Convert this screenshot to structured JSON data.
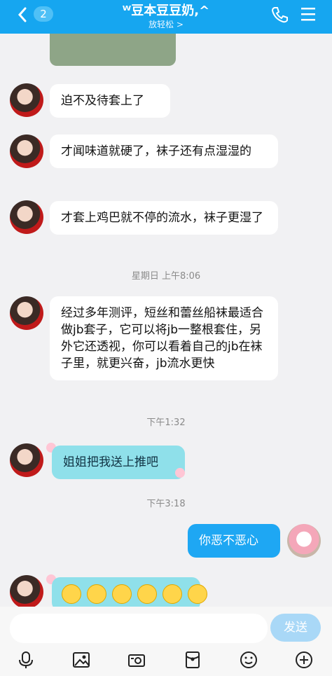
{
  "header": {
    "back_count": "2",
    "title": "ᵂ豆本豆豆奶,^",
    "subtitle": "放轻松 >",
    "colors": {
      "bar": "#16a6f0"
    },
    "icons": [
      "back-arrow-icon",
      "phone-icon",
      "menu-icon"
    ]
  },
  "messages": [
    {
      "from": "them",
      "text": "迫不及待套上了"
    },
    {
      "from": "them",
      "text": "才闻味道就硬了，袜子还有点湿湿的"
    },
    {
      "from": "them",
      "text": "才套上鸡巴就不停的流水，袜子更湿了"
    },
    {
      "time": "星期日 上午8:06"
    },
    {
      "from": "them",
      "text": "经过多年测评，短丝和蕾丝船袜最适合做jb套子，它可以将jb一整根套住，另外它还透视，你可以看着自己的jb在袜子里，就更兴奋，jb流水更快"
    },
    {
      "time": "下午1:32"
    },
    {
      "from": "them",
      "text": "姐姐把我送上推吧",
      "style": "cute"
    },
    {
      "time": "下午3:18"
    },
    {
      "from": "me",
      "text": "你恶不恶心"
    },
    {
      "from": "them",
      "emoji_count": 6,
      "style": "cute"
    }
  ],
  "input": {
    "placeholder": "",
    "send_label": "发送"
  },
  "tools": [
    "mic-icon",
    "image-icon",
    "camera-icon",
    "red-packet-icon",
    "emoji-icon",
    "plus-icon"
  ]
}
